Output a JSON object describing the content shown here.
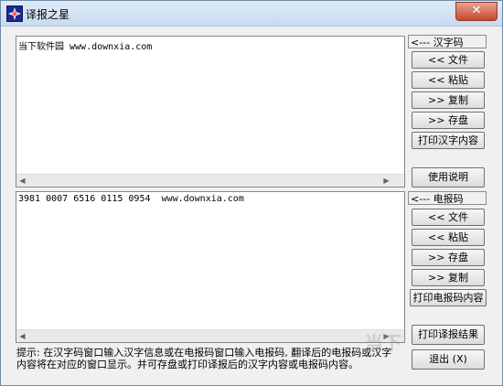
{
  "window": {
    "title": "译报之星",
    "close_label": "✕"
  },
  "hanzi_panel": {
    "text": "当下软件园 www.downxia.com",
    "label": "<--- 汉字码",
    "buttons": {
      "file": "<< 文件",
      "paste": "<< 粘贴",
      "copy": ">> 复制",
      "save": ">> 存盘",
      "print": "打印汉字内容"
    }
  },
  "help_button": "使用说明",
  "code_panel": {
    "text": "3981 0007 6516 0115 0954  www.downxia.com",
    "label": "<--- 电报码",
    "buttons": {
      "file": "<<  文件",
      "paste": "<< 粘贴",
      "save": ">> 存盘",
      "copy": ">> 复制",
      "print": "打印电报码内容"
    }
  },
  "print_result_button": "打印译报结果",
  "exit_button": "退出 (X)",
  "hint": {
    "line1": "提示: 在汉字码窗口输入汉字信息或在电报码窗口输入电报码, 翻译后的电报码或汉字",
    "line2": "内容将在对应的窗口显示。并可存盘或打印译报后的汉字内容或电报码内容。"
  },
  "watermark": "当下"
}
